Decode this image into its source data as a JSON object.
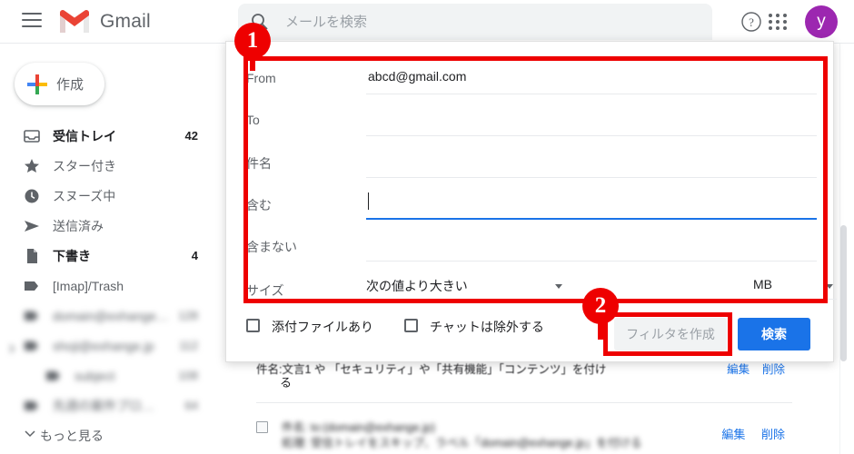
{
  "app": {
    "name": "Gmail",
    "menu_icon": "hamburger-icon",
    "logo_icon": "gmail-logo-icon"
  },
  "search": {
    "placeholder": "メールを検索",
    "value": "",
    "icon": "search-icon"
  },
  "topbar": {
    "help_icon": "help-icon",
    "apps_icon": "apps-grid-icon",
    "avatar_letter": "y",
    "avatar_color": "#9c27b0"
  },
  "sidebar": {
    "compose": {
      "label": "作成",
      "icon": "plus-icon"
    },
    "items": [
      {
        "label": "受信トレイ",
        "count": "42",
        "icon": "inbox-icon",
        "bold": true,
        "blurred": false
      },
      {
        "label": "スター付き",
        "count": "",
        "icon": "star-icon",
        "bold": false,
        "blurred": false
      },
      {
        "label": "スヌーズ中",
        "count": "",
        "icon": "clock-icon",
        "bold": false,
        "blurred": false
      },
      {
        "label": "送信済み",
        "count": "",
        "icon": "send-icon",
        "bold": false,
        "blurred": false
      },
      {
        "label": "下書き",
        "count": "4",
        "icon": "draft-icon",
        "bold": true,
        "blurred": false
      },
      {
        "label": "[Imap]/Trash",
        "count": "",
        "icon": "label-icon",
        "bold": false,
        "blurred": false
      },
      {
        "label": "domain@exhange…",
        "count": "128",
        "icon": "label-icon",
        "bold": false,
        "blurred": true
      },
      {
        "label": "shoji@exhange.jp",
        "count": "112",
        "icon": "label-icon",
        "bold": false,
        "blurred": true
      },
      {
        "label": "subject",
        "count": "108",
        "icon": "label-icon",
        "bold": false,
        "blurred": true
      },
      {
        "label": "先週の案件プロ…",
        "count": "64",
        "icon": "label-icon",
        "bold": false,
        "blurred": true
      }
    ],
    "more": {
      "label": "もっと見る",
      "icon": "chevron-down-icon"
    }
  },
  "dialog": {
    "fields": [
      {
        "label": "From",
        "value": "abcd@gmail.com",
        "focused": false
      },
      {
        "label": "To",
        "value": "",
        "focused": false
      },
      {
        "label": "件名",
        "value": "",
        "focused": false
      },
      {
        "label": "含む",
        "value": "",
        "focused": true
      },
      {
        "label": "含まない",
        "value": "",
        "focused": false
      }
    ],
    "size": {
      "label": "サイズ",
      "operator": "次の値より大きい",
      "value": "",
      "unit": "MB"
    },
    "checkboxes": [
      {
        "label": "添付ファイルあり",
        "checked": false
      },
      {
        "label": "チャットは除外する",
        "checked": false
      }
    ],
    "buttons": {
      "create_filter": "フィルタを作成",
      "search": "検索"
    }
  },
  "background": {
    "filter_rows": [
      {
        "text": "件名: to:(domain@exhange.jp)",
        "sub": "処理: 受信トレイをスキップ、ラベル「domain@exhange.jp」を付ける",
        "edit": "編集",
        "delete": "削除"
      }
    ],
    "cut_row": {
      "text": "件名:文言1 や 「セキュリティ」や「共有機能」「コンテンツ」を付け",
      "edit": "編集",
      "delete": "削除",
      "wrap": "る"
    }
  },
  "annotations": {
    "badges": [
      "1",
      "2"
    ],
    "color": "#ee0000"
  }
}
